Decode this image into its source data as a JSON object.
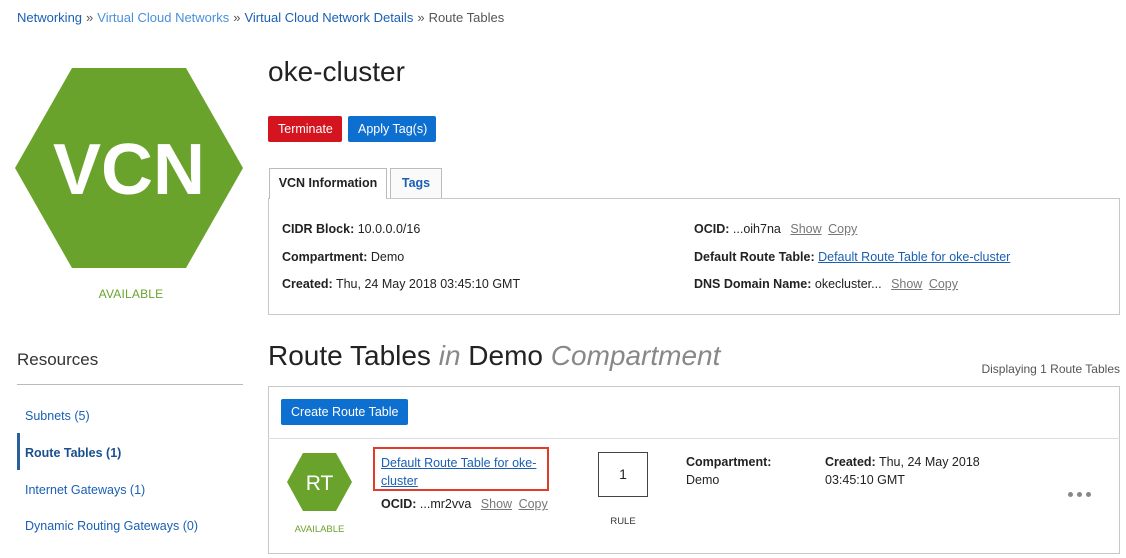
{
  "breadcrumb": {
    "items": [
      "Networking",
      "Virtual Cloud Networks",
      "Virtual Cloud Network Details"
    ],
    "current": "Route Tables",
    "separator": "»"
  },
  "vcn": {
    "icon_text": "VCN",
    "status": "AVAILABLE",
    "title": "oke-cluster",
    "icon_color": "#6aa32c"
  },
  "actions": {
    "terminate": "Terminate",
    "apply_tags": "Apply Tag(s)"
  },
  "tabs": {
    "info": "VCN Information",
    "tags": "Tags"
  },
  "info": {
    "cidr_label": "CIDR Block:",
    "cidr_value": "10.0.0.0/16",
    "compartment_label": "Compartment:",
    "compartment_value": "Demo",
    "created_label": "Created:",
    "created_value": "Thu, 24 May 2018 03:45:10 GMT",
    "ocid_label": "OCID:",
    "ocid_value": "...oih7na",
    "show": "Show",
    "copy": "Copy",
    "default_rt_label": "Default Route Table:",
    "default_rt_value": "Default Route Table for oke-cluster",
    "dns_label": "DNS Domain Name:",
    "dns_value": "okecluster..."
  },
  "resources": {
    "title": "Resources",
    "items": [
      {
        "label": "Subnets (5)"
      },
      {
        "label": "Route Tables (1)"
      },
      {
        "label": "Internet Gateways (1)"
      },
      {
        "label": "Dynamic Routing Gateways (0)"
      }
    ]
  },
  "section": {
    "title_main": "Route Tables",
    "title_in": "in",
    "title_compartment": "Demo",
    "title_suffix": "Compartment",
    "displaying": "Displaying 1 Route Tables",
    "create_button": "Create Route Table"
  },
  "route_table": {
    "icon_text": "RT",
    "status": "AVAILABLE",
    "name": "Default Route Table for oke-cluster",
    "ocid_label": "OCID:",
    "ocid_value": "...mr2vva",
    "show": "Show",
    "copy": "Copy",
    "rule_count": "1",
    "rule_label": "RULE",
    "compartment_label": "Compartment:",
    "compartment_value": "Demo",
    "created_label": "Created:",
    "created_value": "Thu, 24 May 2018",
    "created_time": "03:45:10 GMT"
  },
  "colors": {
    "accent": "#0d6fd0",
    "danger": "#d4141e",
    "available": "#6aa32c",
    "highlight": "#e23b2a"
  },
  "icons": {
    "more": "more-horizontal-icon"
  }
}
